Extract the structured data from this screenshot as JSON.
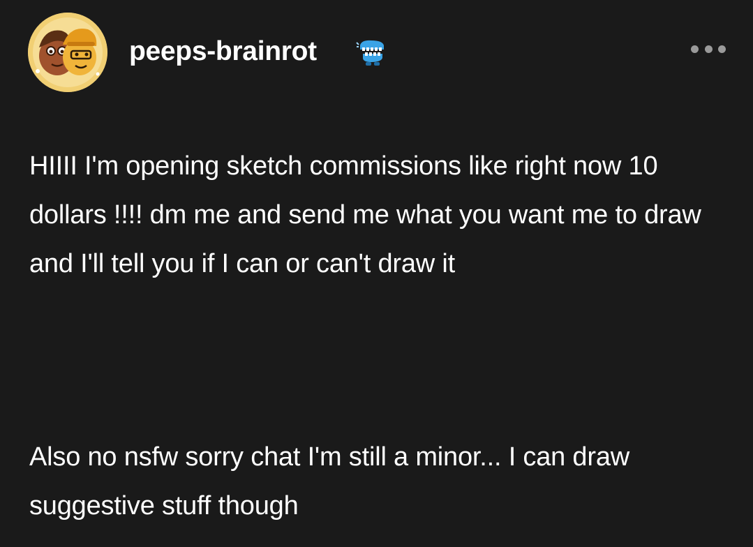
{
  "post": {
    "username": "peeps-brainrot",
    "avatar_icon": "avatar-illustration",
    "badge_icon": "chattering-teeth-badge-icon",
    "more_icon": "more-options-icon",
    "paragraphs": [
      "HIIII I'm opening sketch commissions like right now 10 dollars !!!! dm me and send me what you want me to draw and I'll tell you if I can or can't draw it",
      "Also no nsfw sorry chat I'm still a minor... I can draw suggestive stuff though"
    ]
  },
  "colors": {
    "background": "#1a1a1a",
    "text": "#ffffff",
    "more_dots": "#9a9a9a",
    "avatar_bg": "#f3d27a",
    "badge_blue": "#3aa3e6"
  }
}
